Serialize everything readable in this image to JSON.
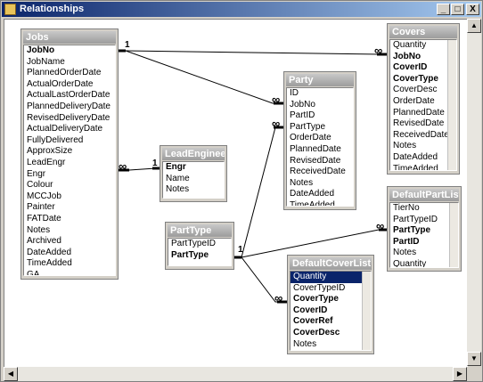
{
  "window": {
    "title": "Relationships",
    "buttons": [
      "_",
      "□",
      "X"
    ]
  },
  "tables": {
    "jobs": {
      "name": "Jobs",
      "fields": [
        {
          "n": "JobNo",
          "k": true
        },
        {
          "n": "JobName"
        },
        {
          "n": "PlannedOrderDate"
        },
        {
          "n": "ActualOrderDate"
        },
        {
          "n": "ActualLastOrderDate"
        },
        {
          "n": "PlannedDeliveryDate"
        },
        {
          "n": "RevisedDeliveryDate"
        },
        {
          "n": "ActualDeliveryDate"
        },
        {
          "n": "FullyDelivered"
        },
        {
          "n": "ApproxSize"
        },
        {
          "n": "LeadEngr"
        },
        {
          "n": "Engr"
        },
        {
          "n": "Colour"
        },
        {
          "n": "MCCJob"
        },
        {
          "n": "Painter"
        },
        {
          "n": "FATDate"
        },
        {
          "n": "Notes"
        },
        {
          "n": "Archived"
        },
        {
          "n": "DateAdded"
        },
        {
          "n": "TimeAdded"
        },
        {
          "n": "GA"
        }
      ]
    },
    "leadengineer": {
      "name": "LeadEngineer",
      "fields": [
        {
          "n": "Engr",
          "k": true
        },
        {
          "n": "Name"
        },
        {
          "n": "Notes"
        }
      ]
    },
    "party": {
      "name": "Party",
      "fields": [
        {
          "n": "ID"
        },
        {
          "n": "JobNo"
        },
        {
          "n": "PartID"
        },
        {
          "n": "PartType"
        },
        {
          "n": "OrderDate"
        },
        {
          "n": "PlannedDate"
        },
        {
          "n": "RevisedDate"
        },
        {
          "n": "ReceivedDate"
        },
        {
          "n": "Notes"
        },
        {
          "n": "DateAdded"
        },
        {
          "n": "TimeAdded"
        }
      ]
    },
    "covers": {
      "name": "Covers",
      "fields": [
        {
          "n": "Quantity"
        },
        {
          "n": "JobNo",
          "k": true
        },
        {
          "n": "CoverID",
          "k": true
        },
        {
          "n": "CoverType",
          "k": true
        },
        {
          "n": "CoverDesc"
        },
        {
          "n": "OrderDate"
        },
        {
          "n": "PlannedDate"
        },
        {
          "n": "RevisedDate"
        },
        {
          "n": "ReceivedDate"
        },
        {
          "n": "Notes"
        },
        {
          "n": "DateAdded"
        },
        {
          "n": "TimeAdded"
        }
      ]
    },
    "defaultpartlist": {
      "name": "DefaultPartList",
      "fields": [
        {
          "n": "TierNo"
        },
        {
          "n": "PartTypeID"
        },
        {
          "n": "PartType",
          "k": true
        },
        {
          "n": "PartID",
          "k": true
        },
        {
          "n": "Notes"
        },
        {
          "n": "Quantity"
        }
      ]
    },
    "parttype": {
      "name": "PartType",
      "fields": [
        {
          "n": "PartTypeID"
        },
        {
          "n": "PartType",
          "k": true
        }
      ]
    },
    "defaultcoverlist": {
      "name": "DefaultCoverList",
      "fields": [
        {
          "n": "Quantity",
          "sel": true
        },
        {
          "n": "CoverTypeID"
        },
        {
          "n": "CoverType",
          "k": true
        },
        {
          "n": "CoverID",
          "k": true
        },
        {
          "n": "CoverRef",
          "k": true
        },
        {
          "n": "CoverDesc",
          "k": true
        },
        {
          "n": "Notes"
        }
      ]
    }
  },
  "relationship_labels": {
    "one": "1",
    "many": "∞"
  }
}
